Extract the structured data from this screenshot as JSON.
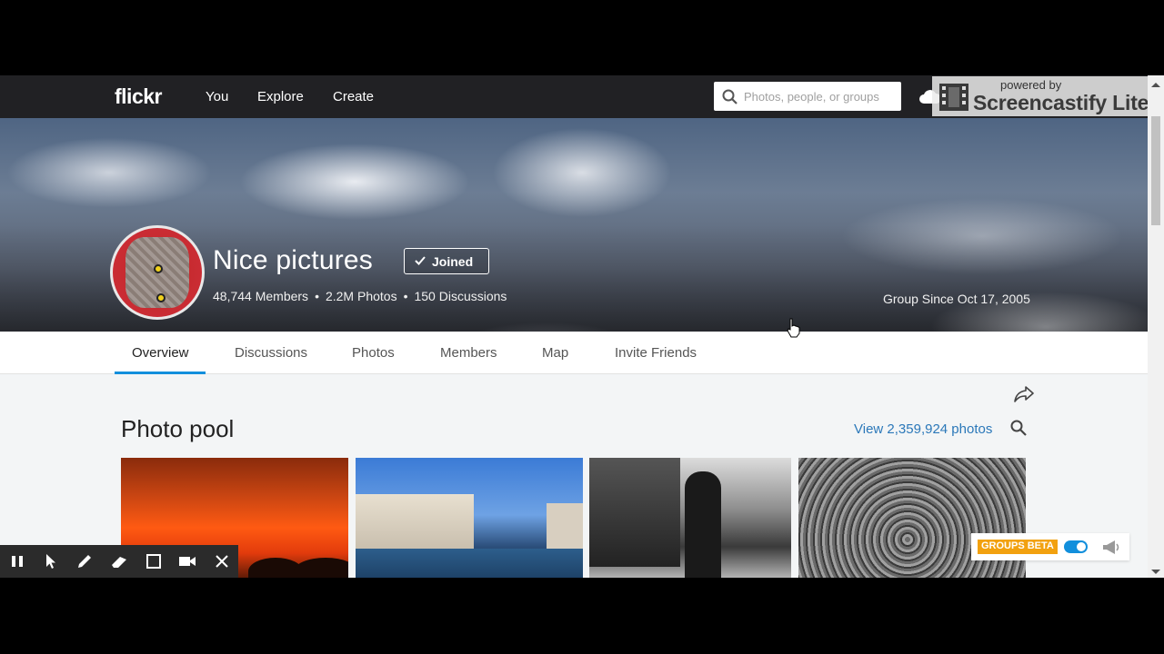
{
  "nav": {
    "logo": "flickr",
    "links": [
      "You",
      "Explore",
      "Create"
    ],
    "search_placeholder": "Photos, people, or groups"
  },
  "watermark": {
    "powered_by": "powered by",
    "title": "Screencastify Lite"
  },
  "group": {
    "name": "Nice pictures",
    "joined_label": "Joined",
    "members": "48,744 Members",
    "photos": "2.2M Photos",
    "discussions": "150 Discussions",
    "separator": "•",
    "since": "Group Since Oct 17, 2005"
  },
  "tabs": [
    "Overview",
    "Discussions",
    "Photos",
    "Members",
    "Map",
    "Invite Friends"
  ],
  "pool": {
    "title": "Photo pool",
    "view_link": "View 2,359,924 photos"
  },
  "groups_beta": {
    "label": "GROUPS BETA",
    "enabled": true
  },
  "colors": {
    "nav_bg": "#212124",
    "accent_blue": "#128fdc",
    "link_blue": "#2b78b9",
    "beta_orange": "#f2a10f"
  }
}
